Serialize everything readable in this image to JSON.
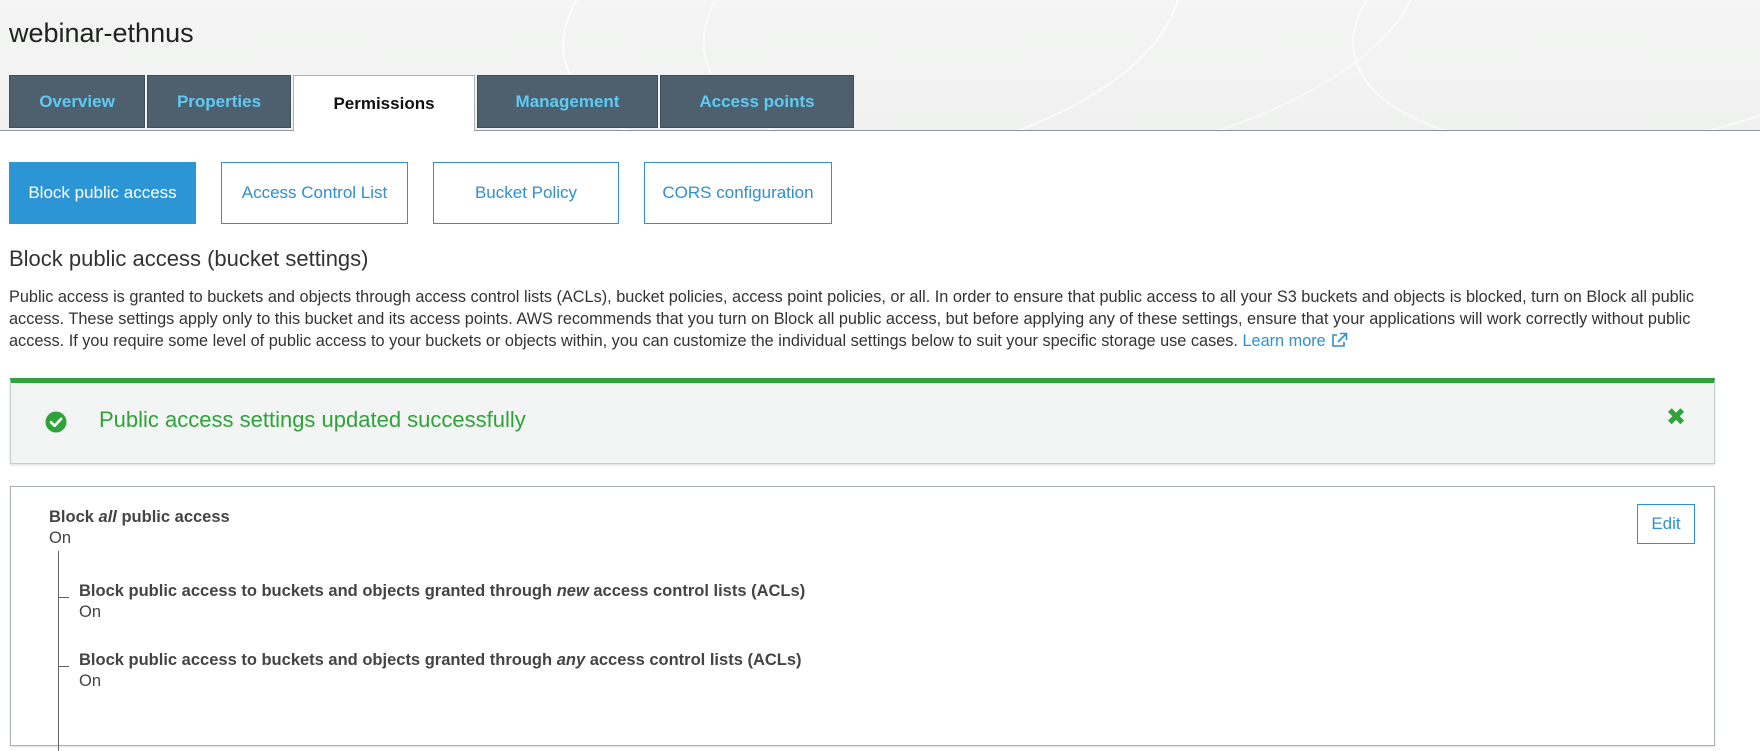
{
  "bucket": {
    "name": "webinar-ethnus"
  },
  "tabs": [
    {
      "label": "Overview",
      "active": false
    },
    {
      "label": "Properties",
      "active": false
    },
    {
      "label": "Permissions",
      "active": true
    },
    {
      "label": "Management",
      "active": false
    },
    {
      "label": "Access points",
      "active": false
    }
  ],
  "subtabs": [
    {
      "label": "Block public access",
      "active": true
    },
    {
      "label": "Access Control List",
      "active": false
    },
    {
      "label": "Bucket Policy",
      "active": false
    },
    {
      "label": "CORS configuration",
      "active": false
    }
  ],
  "section": {
    "heading": "Block public access (bucket settings)",
    "description": "Public access is granted to buckets and objects through access control lists (ACLs), bucket policies, access point policies, or all. In order to ensure that public access to all your S3 buckets and objects is blocked, turn on Block all public access. These settings apply only to this bucket and its access points. AWS recommends that you turn on Block all public access, but before applying any of these settings, ensure that your applications will work correctly without public access. If you require some level of public access to your buckets or objects within, you can customize the individual settings below to suit your specific storage use cases.",
    "learn_more": "Learn more"
  },
  "alert": {
    "message": "Public access settings updated successfully",
    "close_glyph": "✖"
  },
  "settings": {
    "edit_label": "Edit",
    "main": {
      "prefix": "Block ",
      "emphasis": "all",
      "suffix": " public access",
      "value": "On"
    },
    "items": [
      {
        "prefix": "Block public access to buckets and objects granted through ",
        "emphasis": "new",
        "suffix": " access control lists (ACLs)",
        "value": "On"
      },
      {
        "prefix": "Block public access to buckets and objects granted through ",
        "emphasis": "any",
        "suffix": " access control lists (ACLs)",
        "value": "On"
      }
    ]
  },
  "colors": {
    "tab_bg": "#4e606d",
    "tab_text": "#5ecbf5",
    "primary_blue": "#2f8fd0",
    "success_green": "#2ea33a"
  },
  "icons": {
    "alert": "check-circle-icon",
    "close": "close-icon",
    "external": "external-link-icon"
  }
}
